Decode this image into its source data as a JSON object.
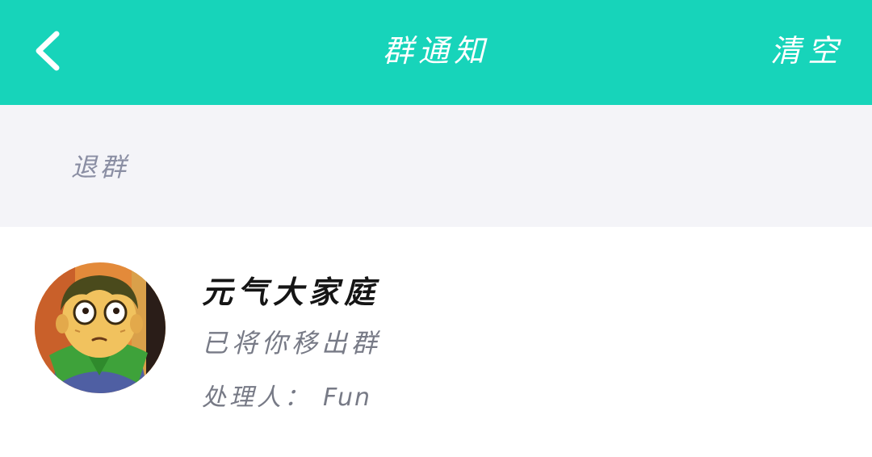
{
  "header": {
    "title": "群通知",
    "clear_label": "清空",
    "background": "#17d4ba"
  },
  "section": {
    "label": "退群"
  },
  "notice": {
    "group_name": "元气大家庭",
    "message": "已将你移出群",
    "handler_label": "处理人：",
    "handler_name": "Fun"
  },
  "icons": {
    "back": "chevron-left-icon",
    "avatar": "group-avatar"
  }
}
